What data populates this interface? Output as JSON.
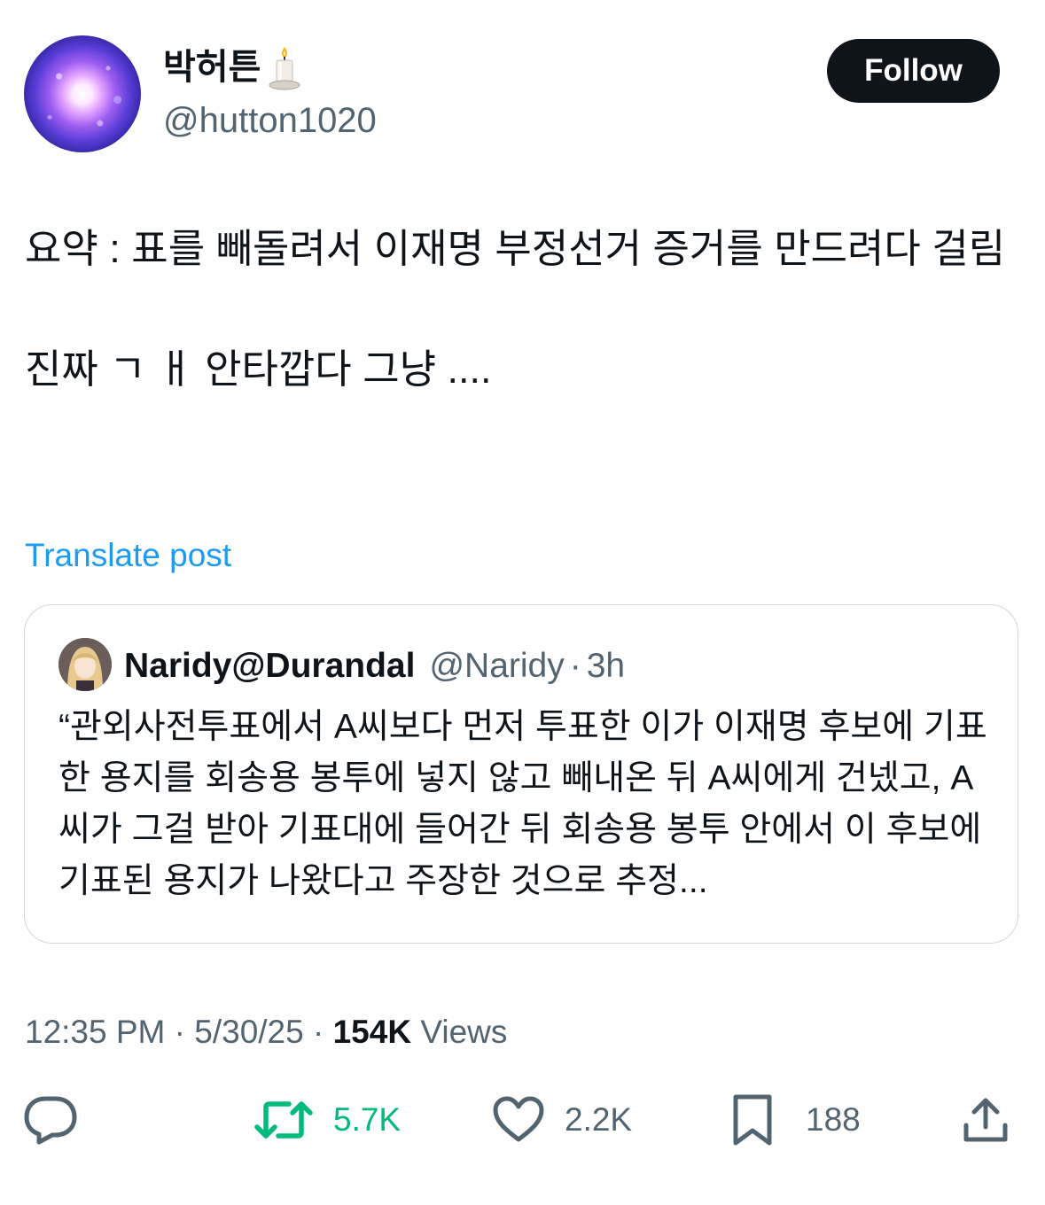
{
  "author": {
    "display_name": "박허튼",
    "name_emoji": "candle-emoji",
    "handle": "@hutton1020",
    "follow_label": "Follow"
  },
  "tweet": {
    "text": "요약 : 표를 빼돌려서 이재명 부정선거 증거를 만드려다 걸림\n\n진짜 ㄱ ㅐ 안타깝다 그냥 ....",
    "translate_label": "Translate post"
  },
  "quote": {
    "name": "Naridy@Durandal",
    "handle": "@Naridy",
    "separator": "·",
    "time": "3h",
    "text": "“관외사전투표에서 A씨보다 먼저 투표한 이가 이재명 후보에 기표한 용지를 회송용 봉투에 넣지 않고 빼내온 뒤 A씨에게 건넸고, A씨가 그걸 받아 기표대에 들어간 뒤 회송용 봉투 안에서 이 후보에 기표된 용지가 나왔다고 주장한 것으로 추정..."
  },
  "meta": {
    "time": "12:35 PM",
    "date": "5/30/25",
    "separator": "·",
    "views_count": "154K",
    "views_label": "Views"
  },
  "actions": {
    "reply": {
      "icon": "reply-icon"
    },
    "repost": {
      "icon": "repost-icon",
      "count": "5.7K",
      "color": "#00ba7c"
    },
    "like": {
      "icon": "heart-icon",
      "count": "2.2K"
    },
    "bookmark": {
      "icon": "bookmark-icon",
      "count": "188"
    },
    "share": {
      "icon": "share-icon"
    }
  },
  "colors": {
    "link": "#1d9bf0",
    "secondary_text": "#536471",
    "primary_text": "#0f1419",
    "border": "#cfd9de"
  }
}
